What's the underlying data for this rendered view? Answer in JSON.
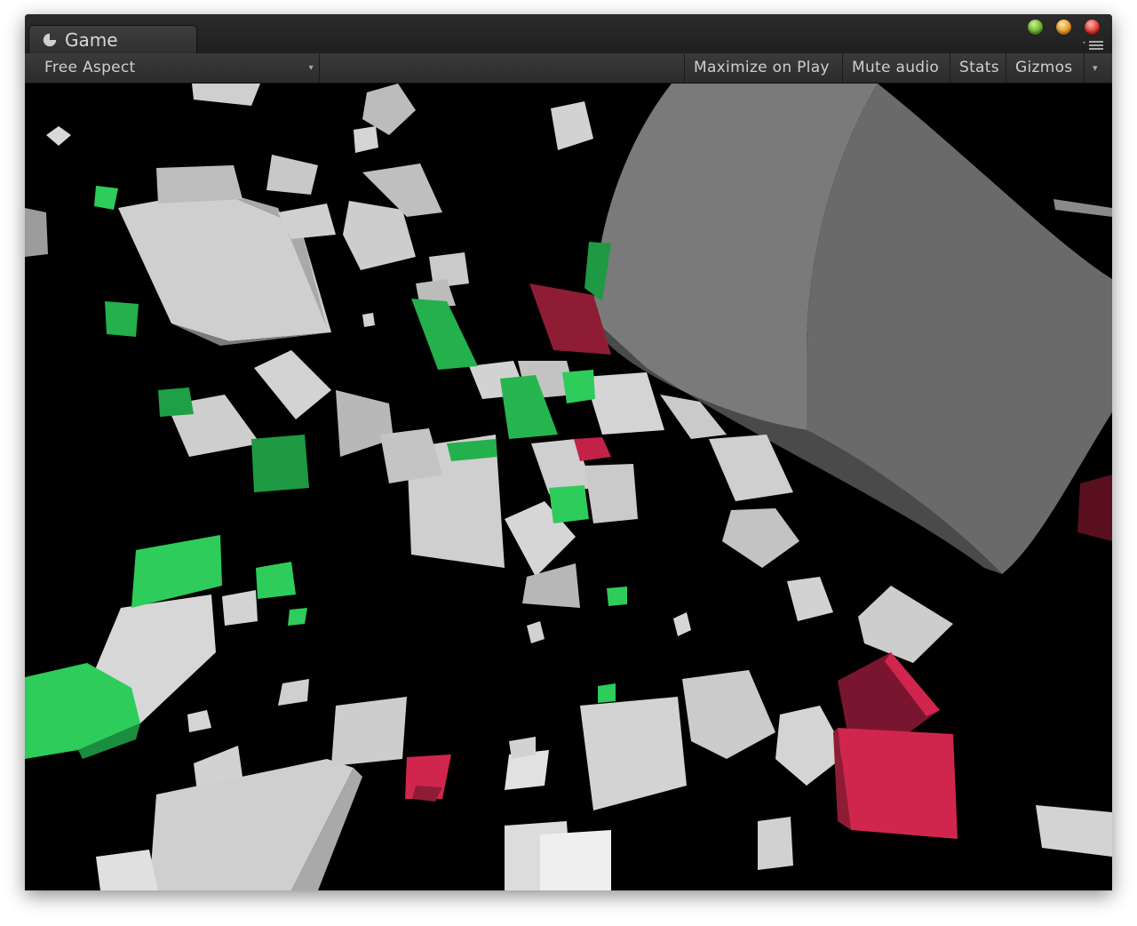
{
  "window": {
    "tab_title": "Game",
    "tab_icon": "pacman-icon"
  },
  "toolbar": {
    "aspect_label": "Free Aspect",
    "maximize_label": "Maximize on Play",
    "mute_label": "Mute audio",
    "stats_label": "Stats",
    "gizmos_label": "Gizmos"
  },
  "colors": {
    "cube_white": "#d2d2d2",
    "cube_green": "#2ecc5a",
    "cube_red": "#d0264e",
    "background": "#000000"
  }
}
